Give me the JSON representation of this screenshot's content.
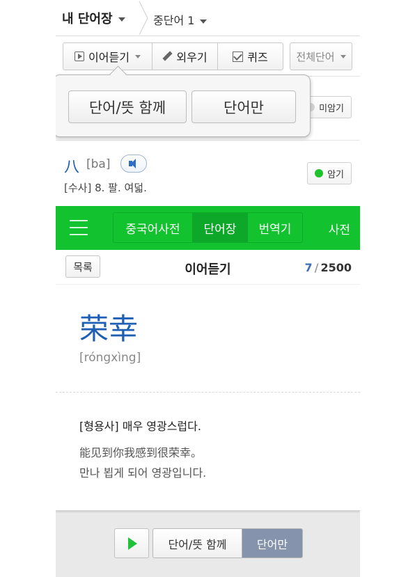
{
  "header": {
    "my_words": "내 단어장",
    "level": "중단어 1"
  },
  "toolbar": {
    "listen": "이어듣기",
    "memorize": "외우기",
    "quiz": "퀴즈",
    "filter": "전체단어"
  },
  "popup": {
    "word_with_meaning": "단어/뜻 함께",
    "word_only": "단어만"
  },
  "words": [
    {
      "status": "미암기",
      "status_color": "#d6d6d6"
    },
    {
      "hanzi": "八",
      "pinyin": "[ba]",
      "meaning": "[수사] 8. 팔. 여덟.",
      "status": "암기",
      "status_color": "#1fc22c"
    }
  ],
  "nav": {
    "tabs": [
      "중국어사전",
      "단어장",
      "번역기"
    ],
    "active_tab": "단어장",
    "dict": "사전",
    "bg_color": "#12c32f"
  },
  "listen": {
    "list_button": "목록",
    "title": "이어듣기",
    "current": "7",
    "total": "2500"
  },
  "card": {
    "hanzi": "荣幸",
    "pinyin": "[róngxìng]",
    "definition": "[형용사] 매우 영광스럽다.",
    "example_cn": "能见到你我感到很荣幸。",
    "example_kr": "만나 뵙게 되어 영광입니다."
  },
  "controls": {
    "option_both": "단어/뜻 함께",
    "option_word": "단어만",
    "selected": "단어만"
  }
}
